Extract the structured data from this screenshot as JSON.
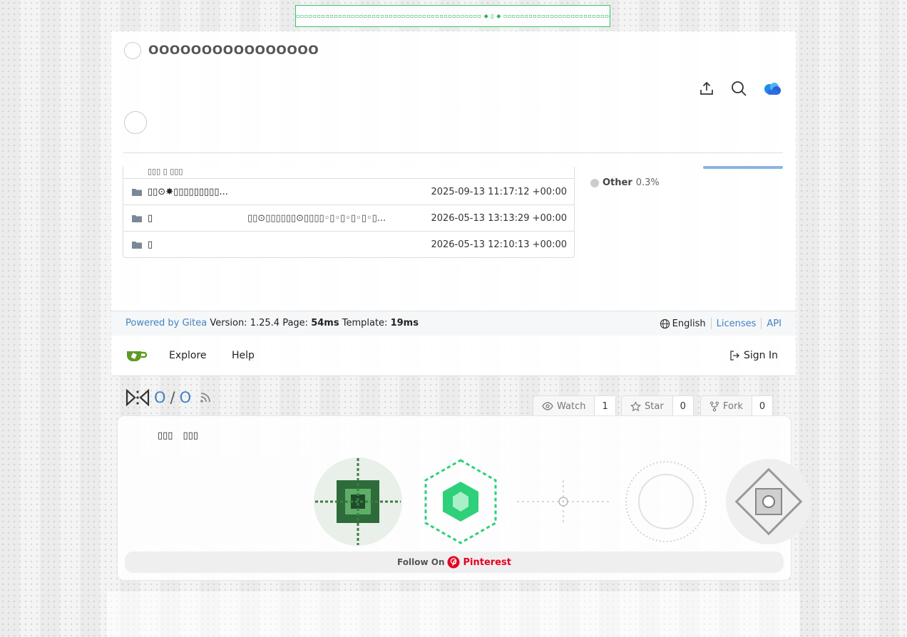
{
  "banner": {
    "text": "▫▫▫▫▫▫▫▫▫▫▫▫▫▫▫▫▫▫▫▫▫▫▫▫▫▫▫▫▫▫▫▫▫▫▫▫▫▫▫▫▫▫▫▫ ◆ ▯ ◆ ▫▫▫▫▫▫▫▫▫▫▫▫▫▫▫▫▫▫▫▫▫▫▫▫▫▫▫▫▫▫▫▫▫▫▫▫▫▫▫▫▫▫▫▫"
  },
  "top_panel": {
    "title": "OOOOOOOOOOOOOOOO",
    "cut_row_text": "▯▯▯ ▯ ▯▯▯",
    "files": [
      {
        "name": "▯▯⊙✸▯▯▯▯▯▯▯▯▯...",
        "message": "",
        "time": "2025-09-13 11:17:12 +00:00"
      },
      {
        "name": "▯",
        "message": "▯▯⊙▯▯▯▯▯▯⊙▯▯▯▯◦▯◦▯◦▯◦▯◦▯...",
        "time": "2026-05-13 13:13:29 +00:00"
      },
      {
        "name": "▯",
        "message": "",
        "time": "2026-05-13 12:10:13 +00:00"
      }
    ],
    "language": {
      "name": "Other",
      "percent": "0.3%",
      "color": "#cccccc"
    }
  },
  "footer": {
    "powered_by": "Powered by Gitea",
    "version_label": "Version:",
    "version": "1.25.4",
    "page_label": "Page:",
    "page_time": "54ms",
    "template_label": "Template:",
    "template_time": "19ms",
    "language": "English",
    "licenses": "Licenses",
    "api": "API"
  },
  "navbar": {
    "explore": "Explore",
    "help": "Help",
    "sign_in": "Sign In"
  },
  "repo": {
    "owner": "O",
    "name": "O",
    "watch_label": "Watch",
    "watch_count": "1",
    "star_label": "Star",
    "star_count": "0",
    "fork_label": "Fork",
    "fork_count": "0"
  },
  "embed": {
    "tab1": "▯▯▯",
    "tab2": "▯▯▯",
    "follow_text": "Follow On",
    "brand": "Pinterest"
  },
  "colors": {
    "link": "#4183c4",
    "gitea_green": "#609926",
    "pinterest_red": "#e60023",
    "accent_green": "#2fb35f"
  }
}
